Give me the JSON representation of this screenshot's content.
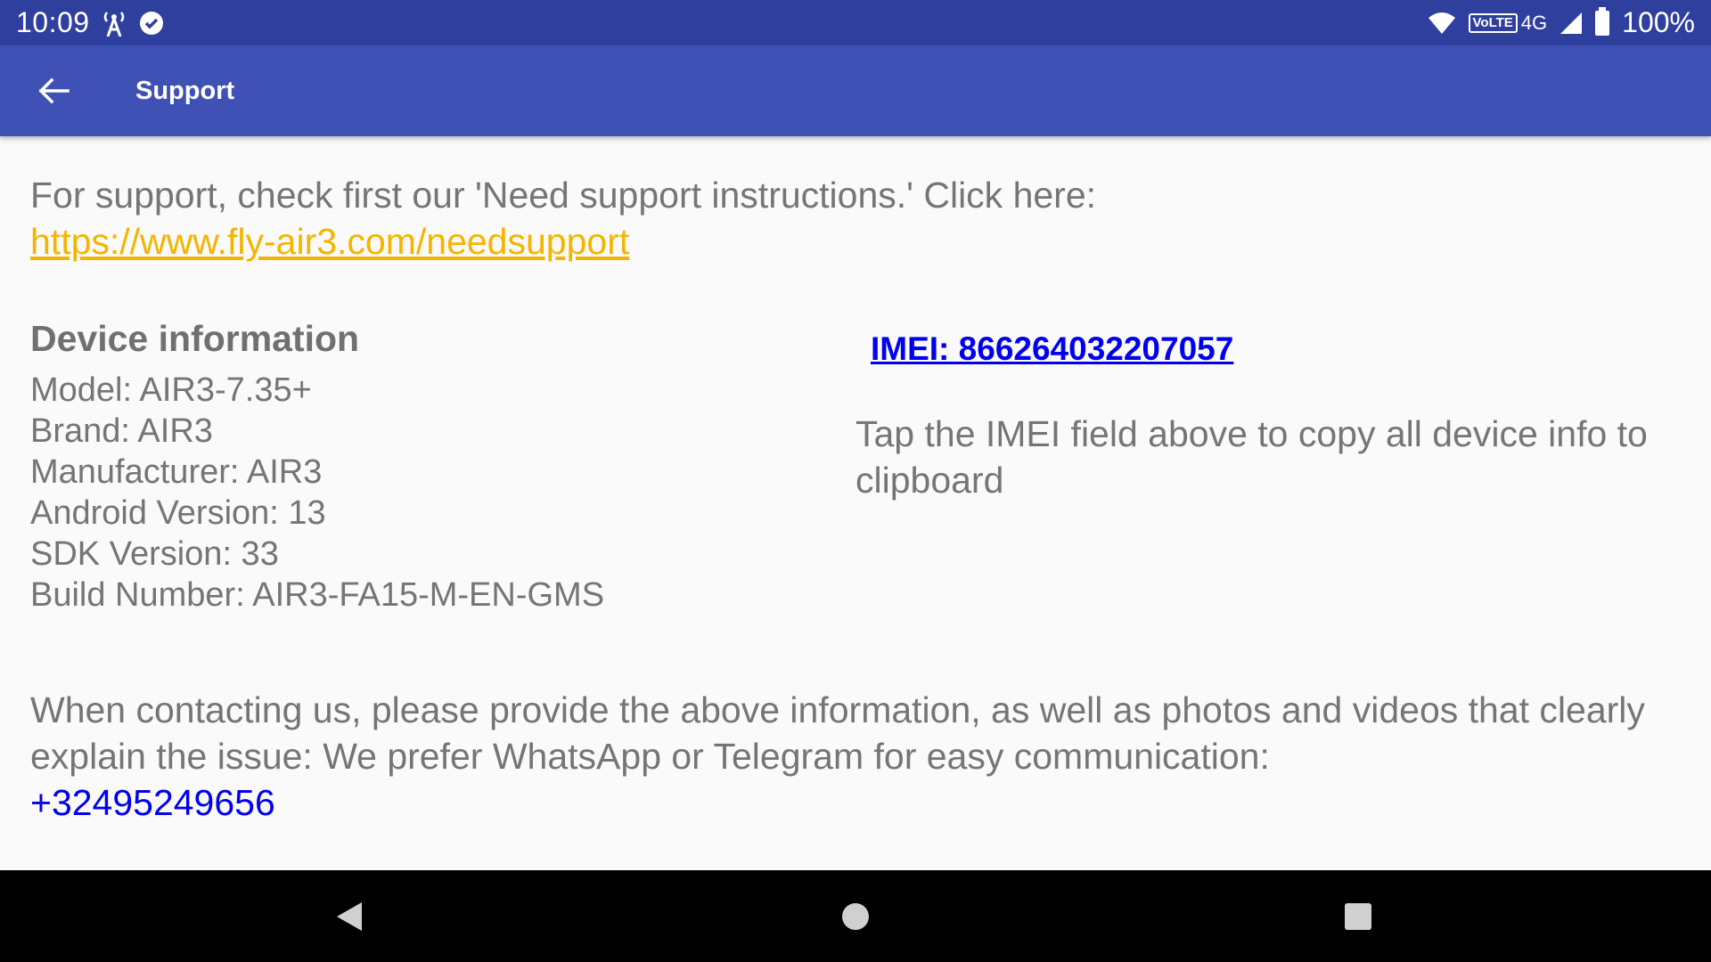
{
  "status_bar": {
    "time": "10:09",
    "left_icons": [
      "signal-tower-icon",
      "sync-check-icon"
    ],
    "volte": "VoLTE",
    "network": "4G",
    "battery_pct": "100%"
  },
  "app_bar": {
    "title": "Support",
    "back_icon": "arrow-back-icon"
  },
  "intro": {
    "text": "For support, check first our 'Need support instructions.' Click here:",
    "link": "https://www.fly-air3.com/needsupport"
  },
  "device": {
    "heading": "Device information",
    "lines": [
      "Model: AIR3-7.35+",
      "Brand: AIR3",
      "Manufacturer: AIR3",
      "Android Version: 13",
      "SDK Version: 33",
      "Build Number: AIR3-FA15-M-EN-GMS"
    ],
    "imei": "IMEI: 866264032207057",
    "imei_hint": "Tap the IMEI field above to copy all device info to clipboard"
  },
  "contact": {
    "text": "When contacting us, please provide the above information, as well as photos and videos that clearly explain the issue: We prefer WhatsApp or Telegram for easy communication:",
    "phone": "+32495249656"
  },
  "colors": {
    "status_bar": "#2f3f9e",
    "app_bar": "#3f51b5",
    "support_link": "#f5b400",
    "blue_link": "#0000ee",
    "body_text": "#757575"
  },
  "nav_bar": {
    "icons": [
      "nav-back-icon",
      "nav-home-icon",
      "nav-recents-icon"
    ]
  }
}
